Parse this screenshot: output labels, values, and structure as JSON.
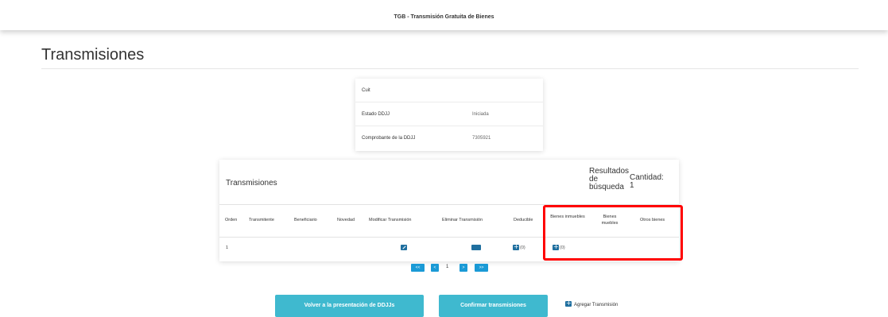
{
  "app": {
    "title": "TGB - Transmisión Gratuita de Bienes"
  },
  "page": {
    "title": "Transmisiones"
  },
  "info": {
    "rows": [
      {
        "label": "Cuit",
        "value": ""
      },
      {
        "label": "Estado DDJJ",
        "value": "Iniciada"
      },
      {
        "label": "Comprobante de la DDJJ",
        "value": "7305921"
      }
    ]
  },
  "transmisiones": {
    "title": "Transmisiones",
    "results_label": "Resultados de búsqueda",
    "cantidad_label": "Cantidad: 1",
    "columns": [
      "Orden",
      "Transmitente",
      "Beneficiario",
      "Novedad",
      "Modificar Transmisión",
      "Eliminar Transmisión",
      "Deducible",
      "Bienes inmuebles",
      "Bienes muebles",
      "Otros bienes"
    ],
    "rows": [
      {
        "orden": "1",
        "deducible_count": "(0)",
        "inmuebles_count": "(0)"
      }
    ]
  },
  "pager": {
    "first": "<<",
    "prev": "<",
    "page": "1",
    "next": ">",
    "last": ">>"
  },
  "actions": {
    "back_label": "Volver a la presentación de DDJJs",
    "confirm_label": "Confirmar transmisiones",
    "add_label": "Agregar Transmisión"
  },
  "colors": {
    "primary_button": "#3fb9cf",
    "pager": "#1a9ad6",
    "icon": "#1f6f9f",
    "highlight": "#ff0000"
  }
}
